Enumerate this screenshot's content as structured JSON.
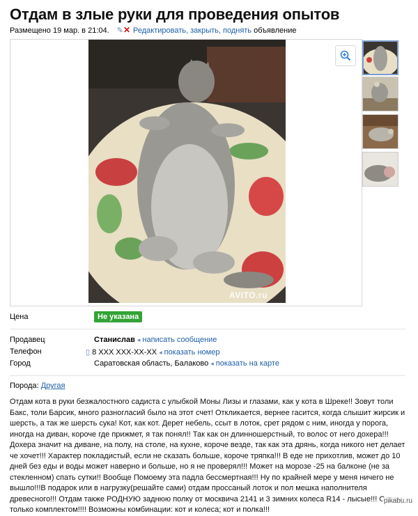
{
  "title": "Отдам в злые руки для проведения опытов",
  "meta": {
    "posted": "Размещено 19 мар. в 21:04.",
    "edit_link": "Редактировать, закрыть, поднять",
    "edit_suffix": "объявление"
  },
  "gallery": {
    "watermark": "AVITO.ru",
    "zoom_icon": "zoom-in-icon"
  },
  "price": {
    "label": "Цена",
    "value": "Не указана"
  },
  "seller": {
    "label": "Продавец",
    "name": "Станислав",
    "action": "написать сообщение"
  },
  "phone": {
    "label": "Телефон",
    "number": "8 XXX XXX-XX-XX",
    "action": "показать номер"
  },
  "city": {
    "label": "Город",
    "value": "Саратовская область, Балаково",
    "action": "показать на карте"
  },
  "breed": {
    "label": "Порода:",
    "value": "Другая"
  },
  "description": "Отдам кота в руки безжалостного садиста с улыбкой Моны Лизы и глазами, как у кота в Шреке!! Зовут толи Бакс, толи Барсик, много разногласий было на этот счет! Откликается, вернее гасится, когда слышит жирсик и шерсть, а так же шерсть сука! Кот, как кот. Дерет небель, ссыт в лоток, срет рядом с ним, иногда у порога, иногда на диван, короче где прижмет, я так понял!! Так как он длинношерстный, то волос от него дохера!!! Дохера значит на диване, на полу, на столе, на кухне, короче везде, так как эта дрянь, когда никого нет делает че хочет!!! Характер покладистый, если не сказать больше, короче тряпка!!! В еде не прихотлив, может до 10 дней без еды и воды может наверно и больше, но я не проверял!!! Может на морозе -25 на балконе (не за стекленном) спать сутки!! Вообще Помоему эта падла бессмертная!!! Ну по крайней мере у меня ничего не вышло!!!В подарок или в нагрузку(решайте сами) отдам проссаный лоток и пол мешка наполнителя древесного!!! Отдам также РОДНУЮ заднюю полку от москвича 2141 и 3 зимних колеса R14 - лысые!!! Отдам только комплектом!!!! Возможны комбинации: кот и колеса; кот и полка!!!",
  "footer": {
    "watermark": "pikabu.ru"
  },
  "colors": {
    "link": "#1d5ea8",
    "price_badge": "#33a336"
  }
}
